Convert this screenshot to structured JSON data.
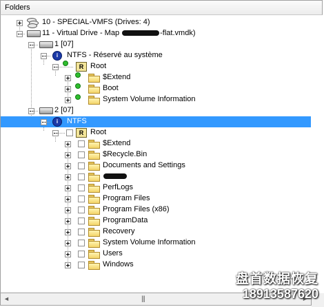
{
  "panel": {
    "title": "Folders"
  },
  "tree": {
    "vmfs_label": "10 - SPECIAL-VMFS (Drives: 4)",
    "vdrive_label_prefix": "11 - Virtual Drive - Map ",
    "vdrive_label_suffix": "-flat.vmdk)",
    "partition1_label": "1 [07]",
    "ntfs_reserved_label": "NTFS - Réservé au système",
    "root1_label": "Root",
    "root1_children": [
      "$Extend",
      "Boot",
      "System Volume Information"
    ],
    "partition2_label": "2 [07]",
    "ntfs2_label": "NTFS",
    "root2_label": "Root",
    "root2_children": [
      "$Extend",
      "$Recycle.Bin",
      "Documents and Settings",
      "",
      "PerfLogs",
      "Program Files",
      "Program Files (x86)",
      "ProgramData",
      "Recovery",
      "System Volume Information",
      "Users",
      "Windows"
    ],
    "root_badge": "R",
    "ntfs_badge": "i"
  },
  "scrollbar": {
    "left_arrow": "◄",
    "right_arrow": "►",
    "grip": "|||"
  },
  "watermark": {
    "line1": "盘首数据恢复",
    "line2": "18913587620"
  },
  "colors": {
    "selection": "#3399ff",
    "connector": "#2fbd2f"
  }
}
